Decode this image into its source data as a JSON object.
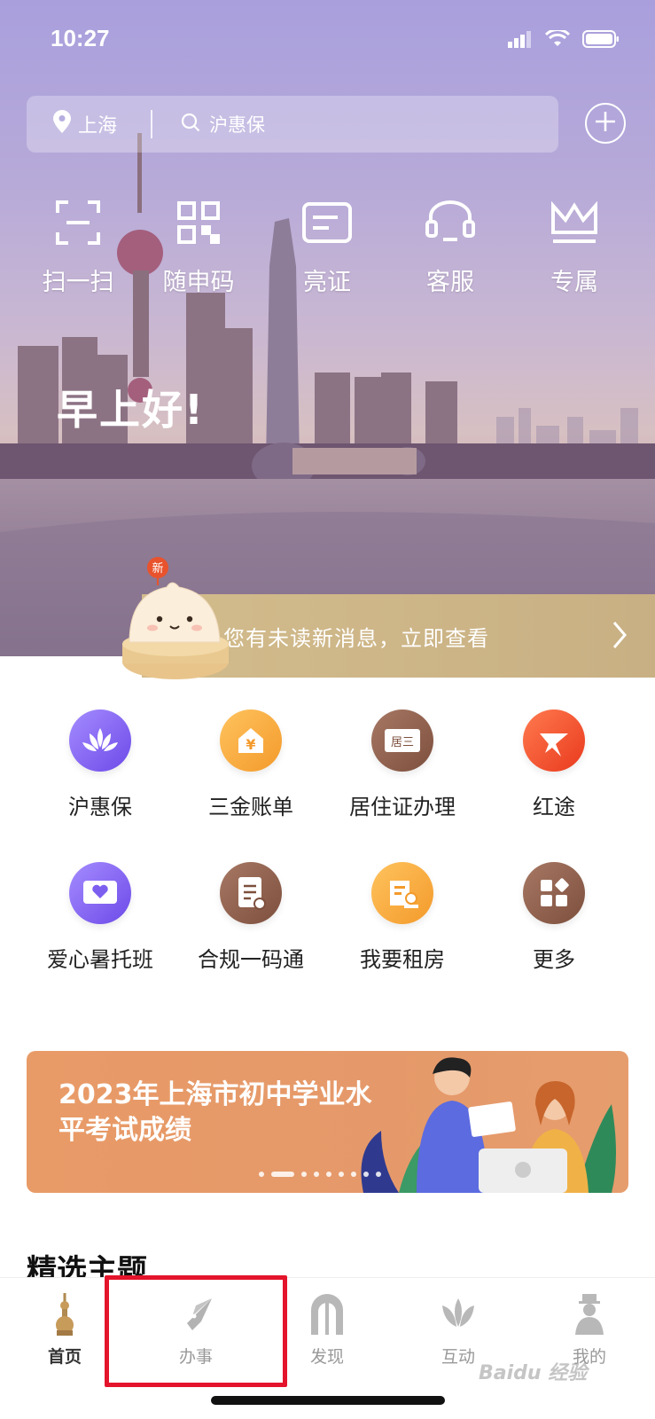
{
  "status_bar": {
    "time": "10:27"
  },
  "search": {
    "location": "上海",
    "query_placeholder": "沪惠保"
  },
  "quick_actions": [
    {
      "label": "扫一扫",
      "icon": "scan-icon"
    },
    {
      "label": "随申码",
      "icon": "qr-code-icon"
    },
    {
      "label": "亮证",
      "icon": "card-icon"
    },
    {
      "label": "客服",
      "icon": "headset-icon"
    },
    {
      "label": "专属",
      "icon": "crown-icon"
    }
  ],
  "greeting": "早上好!",
  "message_banner": {
    "badge": "新",
    "text": "您有未读新消息，立即查看"
  },
  "services": [
    {
      "label": "沪惠保",
      "icon": "lotus-icon",
      "color": "#7d5ff0"
    },
    {
      "label": "三金账单",
      "icon": "yuan-house-icon",
      "color": "#f0a53a"
    },
    {
      "label": "居住证办理",
      "icon": "residence-card-icon",
      "color": "#8a5a48"
    },
    {
      "label": "红途",
      "icon": "red-star-icon",
      "color": "#ee4a2a"
    },
    {
      "label": "爱心暑托班",
      "icon": "heart-screen-icon",
      "color": "#7d5ff0"
    },
    {
      "label": "合规一码通",
      "icon": "document-icon",
      "color": "#8a5a48"
    },
    {
      "label": "我要租房",
      "icon": "rent-house-icon",
      "color": "#f0a53a"
    },
    {
      "label": "更多",
      "icon": "more-grid-icon",
      "color": "#8a5a48"
    }
  ],
  "promo": {
    "title": "2023年上海市初中学业水平考试成绩"
  },
  "featured_section_title": "精选主题",
  "tabs": [
    {
      "label": "首页",
      "icon": "home-tower-icon"
    },
    {
      "label": "办事",
      "icon": "pen-icon"
    },
    {
      "label": "发现",
      "icon": "arch-icon"
    },
    {
      "label": "互动",
      "icon": "magnolia-icon"
    },
    {
      "label": "我的",
      "icon": "person-icon"
    }
  ],
  "watermark": "Baidu 经验"
}
